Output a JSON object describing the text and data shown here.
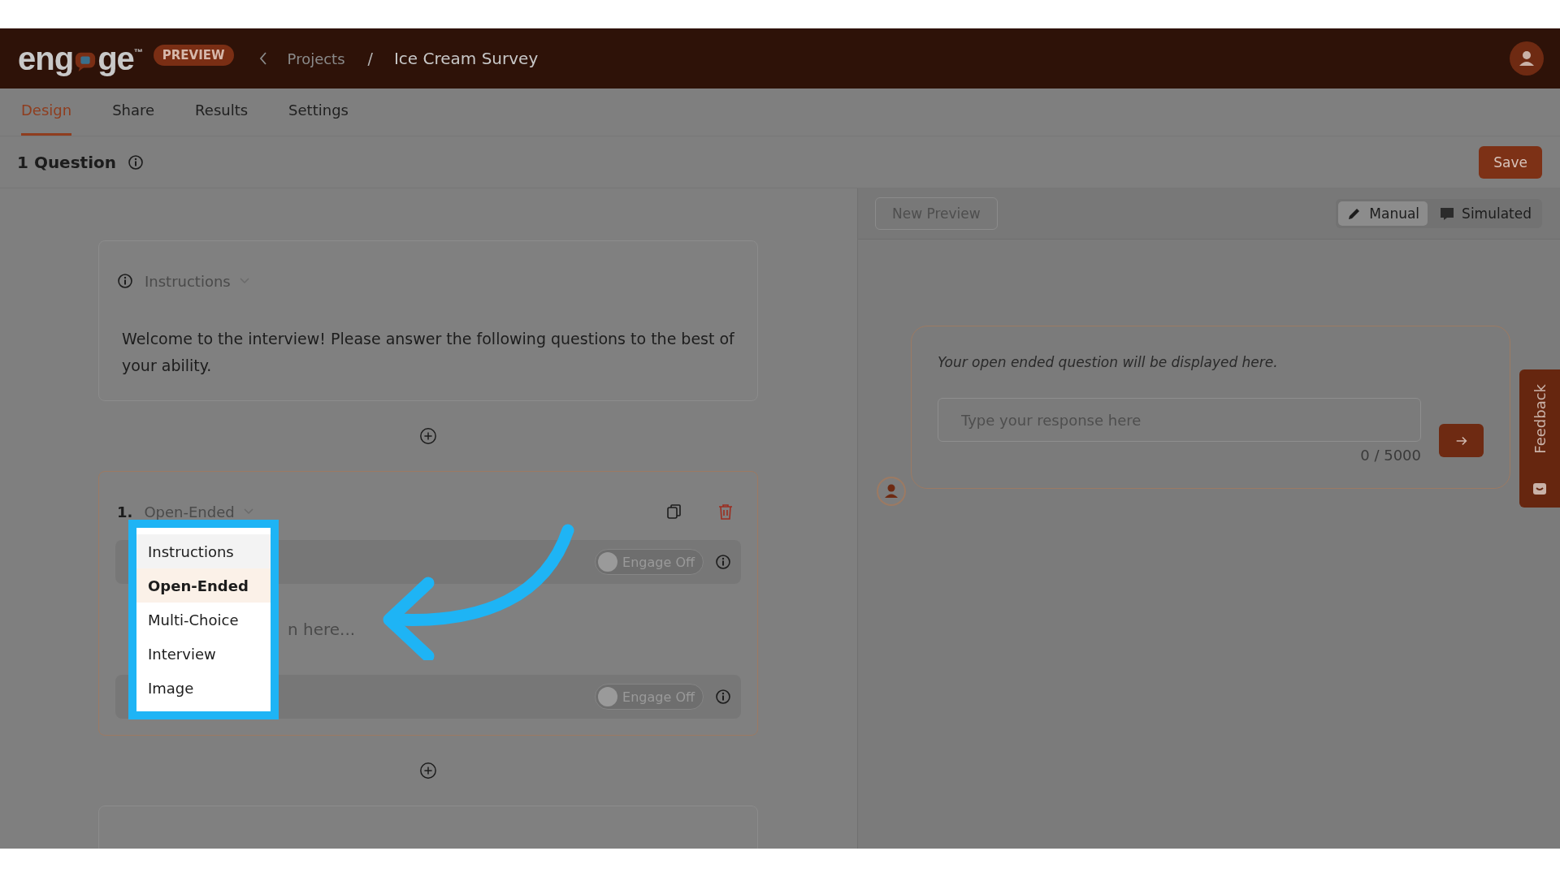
{
  "header": {
    "logo_before": "eng",
    "logo_after": "ge",
    "logo_mark": "™",
    "badge": "PREVIEW",
    "back_link": "Projects",
    "separator": "/",
    "current": "Ice Cream Survey"
  },
  "tabs": [
    {
      "label": "Design",
      "selected": true
    },
    {
      "label": "Share",
      "selected": false
    },
    {
      "label": "Results",
      "selected": false
    },
    {
      "label": "Settings",
      "selected": false
    }
  ],
  "toolbar": {
    "title": "1 Question",
    "save": "Save"
  },
  "instructions_block": {
    "type_label": "Instructions",
    "text": "Welcome to the interview! Please answer the following questions to the best of your ability."
  },
  "question_block": {
    "number": "1.",
    "type_label": "Open-Ended",
    "placeholder_fragment": "n here...",
    "rows": [
      {
        "toggle_label": "Engage Off",
        "on": false
      },
      {
        "toggle_label": "Engage Off",
        "on": false
      }
    ]
  },
  "type_menu": {
    "items": [
      {
        "label": "Instructions",
        "selected": false,
        "hovered": true
      },
      {
        "label": "Open-Ended",
        "selected": true,
        "hovered": false
      },
      {
        "label": "Multi-Choice",
        "selected": false,
        "hovered": false
      },
      {
        "label": "Interview",
        "selected": false,
        "hovered": false
      },
      {
        "label": "Image",
        "selected": false,
        "hovered": false
      }
    ]
  },
  "preview": {
    "new_preview": "New Preview",
    "modes": [
      {
        "kind": "manual",
        "label": "Manual",
        "selected": true
      },
      {
        "kind": "simulated",
        "label": "Simulated",
        "selected": false
      }
    ],
    "question": "Your open ended question will be displayed here.",
    "response_placeholder": "Type your response here",
    "counter": "0 / 5000"
  },
  "feedback": "Feedback"
}
